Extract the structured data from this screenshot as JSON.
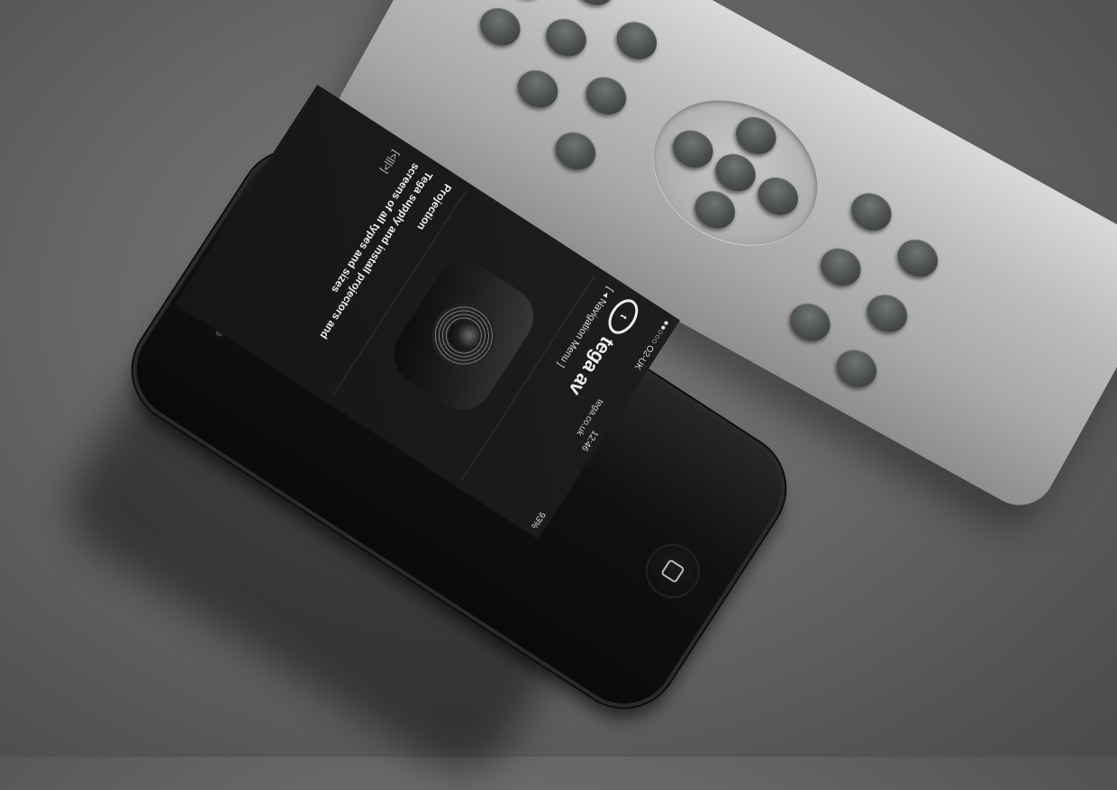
{
  "phone": {
    "status": {
      "carrier": "●●○○○ O2-UK",
      "time": "12:46",
      "battery": "93%"
    },
    "url": "tega.co.uk",
    "site": {
      "logo_mark": "t",
      "brand": "tega av",
      "nav_menu": "[ ◂ Navigation Menu ]",
      "hero_alt": "projector",
      "caption_title": "Projection",
      "caption_body": "Tega supply and install projectors and screens of all types and sizes",
      "pager": "[<|||>]"
    }
  }
}
